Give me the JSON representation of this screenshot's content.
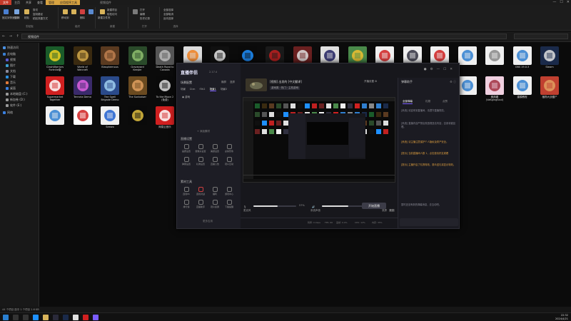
{
  "explorer": {
    "tabs": [
      "文件",
      "主页",
      "共享",
      "查看",
      "管理",
      "应用程序工具",
      "管理"
    ],
    "window_title": "视频组件",
    "center_title": "",
    "ribbon_groups": [
      "剪贴板",
      "组织",
      "新建",
      "打开",
      "选择"
    ],
    "ribbon_items": [
      "固定到快速访问",
      "复制",
      "粘贴",
      "剪切",
      "复制路径",
      "粘贴快捷方式",
      "移动到",
      "复制到",
      "删除",
      "重命名",
      "新建文件夹",
      "新建项目",
      "轻松访问",
      "属性",
      "打开",
      "编辑",
      "历史记录",
      "全部选择",
      "全部取消",
      "反向选择"
    ],
    "address_path": "视频组件",
    "nav_arrows": "← → ↑"
  },
  "sidebar": {
    "items": [
      "快速访问",
      "此电脑",
      "视频",
      "图片",
      "文档",
      "下载",
      "音乐",
      "桌面",
      "本地磁盘 (C:)",
      "新加卷 (D:)",
      "软件 (E:)",
      "网络"
    ]
  },
  "files": [
    {
      "label": "ClashWarriors Fortnite版",
      "color": "#1a5c2a",
      "accent": "#f0d020"
    },
    {
      "label": "World of Warcraft",
      "color": "#3a2a10",
      "accent": "#d4a94a"
    },
    {
      "label": "Blasphemous",
      "color": "#5a3a20",
      "accent": "#c08050"
    },
    {
      "label": "Graveyard Keeper",
      "color": "#2a4a2a",
      "accent": "#8fbf6f"
    },
    {
      "label": "Death Road to Canada",
      "color": "#555555",
      "accent": "#bbbbbb"
    },
    {
      "label": "Untitled Goose Game",
      "color": "#dcdcdc",
      "accent": "#f08020"
    },
    {
      "label": "Hollow Knight",
      "color": "#101010",
      "accent": "#e8e8e8"
    },
    {
      "label": "Internet Explorer",
      "color": "#0a0a0a",
      "accent": "#1e90ff"
    },
    {
      "label": "Ys",
      "color": "#1a1a1a",
      "accent": "#c02020"
    },
    {
      "label": "Hand of Fate",
      "color": "#6a2020",
      "accent": "#e0e0e0"
    },
    {
      "label": "Ramshackle",
      "color": "#e0e0e0",
      "accent": "#202060"
    },
    {
      "label": "Overcooked 2",
      "color": "#4a8a4a",
      "accent": "#f0c030"
    },
    {
      "label": "Unrailed!",
      "color": "#f0f0f0",
      "accent": "#d02020"
    },
    {
      "label": "SteamVR",
      "color": "#f0f0f0",
      "accent": "#303040"
    },
    {
      "label": "Nine Parchments",
      "color": "#f0f0f0",
      "accent": "#d02020"
    },
    {
      "label": "",
      "color": "#f0f0f0",
      "accent": "#2f7fd0"
    },
    {
      "label": "",
      "color": "#f0f0f0",
      "accent": "#888888"
    },
    {
      "label": "OBS 19.0.3",
      "color": "#f0f0f0",
      "accent": "#2f7fd0"
    },
    {
      "label": "Steam",
      "color": "#1a2a4a",
      "accent": "#e0e0e0"
    },
    {
      "label": "Supermarket Together",
      "color": "#d02020",
      "accent": "#ffffff"
    },
    {
      "label": "Terraria Demo",
      "color": "#3a2a6a",
      "accent": "#e060e0"
    },
    {
      "label": "The Spell Brigade Demo",
      "color": "#2a4a8a",
      "accent": "#a0d0f0"
    },
    {
      "label": "The Sunkaiser",
      "color": "#6a4a20",
      "accent": "#e0a060"
    },
    {
      "label": "To the Moon 2 (免费)",
      "color": "#0a0a0a",
      "accent": "#dddddd"
    },
    {
      "label": "",
      "color": "#0a0a0a",
      "accent": "#888888"
    },
    {
      "label": "大雁服务",
      "color": "#f0f0f0",
      "accent": "#e0a0c0"
    },
    {
      "label": "大理石模拟器",
      "color": "#2a5a8a",
      "accent": "#f0f0f0"
    },
    {
      "label": "魔兽世界",
      "color": "#2a2a2a",
      "accent": "#d4a94a"
    },
    {
      "label": "猫咪的小",
      "color": "#f0f0f0",
      "accent": "#2f7fd0"
    },
    {
      "label": "明星大乱斗",
      "color": "#d04020",
      "accent": "#ffffff"
    },
    {
      "label": "",
      "color": "#2a2a2a",
      "accent": "#e0e0e0"
    },
    {
      "label": "大雁逃脱",
      "color": "#d06020",
      "accent": "#ffffff"
    },
    {
      "label": "沙盒游戏",
      "color": "#f0f0f0",
      "accent": "#c03030"
    },
    {
      "label": "",
      "color": "#f0f0f0",
      "accent": "#b0b0b0"
    },
    {
      "label": "",
      "color": "#f0f0f0",
      "accent": "#2f7fd0"
    },
    {
      "label": "雅典娜(VaKgingSoul)",
      "color": "#f0d0e0",
      "accent": "#a03040"
    },
    {
      "label": "建模教程",
      "color": "#f0f0f0",
      "accent": "#2f7fd0"
    },
    {
      "label": "植物大战僵尸",
      "color": "#c04030",
      "accent": "#e0a060"
    },
    {
      "label": "",
      "color": "#f0f0f0",
      "accent": "#2f7fd0"
    },
    {
      "label": "",
      "color": "#ffffff",
      "accent": "#d02020"
    },
    {
      "label": "Seewo",
      "color": "#f0f0f0",
      "accent": "#2060d0"
    },
    {
      "label": "",
      "color": "#0a0a0a",
      "accent": "#e0c040"
    },
    {
      "label": "网易云音乐",
      "color": "#d02020",
      "accent": "#ffffff"
    },
    {
      "label": "",
      "color": "#20b020",
      "accent": "#ffffff"
    }
  ],
  "status_bar": "44 个项目   选中 1 个项目 1.6 KB",
  "taskbar": {
    "time": "22:32",
    "date": "2024/4/21"
  },
  "app": {
    "logo": "直播伴侣",
    "version": "2.17.4",
    "scene_header": "场景配置",
    "scene_tabs": [
      "横屏",
      "竖屏"
    ],
    "scene_items": [
      "场景",
      "D:m",
      "f3h2",
      "场景1",
      "场景2"
    ],
    "add_source": "+ 添加素材",
    "source_item": "游戏",
    "panel_quick": "直播设置",
    "quick_tools": [
      "画质设置",
      "摄像头设置",
      "美颜设置",
      "虚拟形象",
      "弹幕设置",
      "礼物设置",
      "直播公告",
      "观众互动"
    ],
    "panel_tools": "素材工具",
    "tools": [
      "连线PK",
      "连线对战",
      "福利",
      "游戏中心",
      "排行榜",
      "直播助手",
      "观众投屏",
      "下播提醒"
    ],
    "more_tools": "更多应用",
    "stream_title": "[视频] 出发的 [中文翻译]",
    "stream_category": "游戏类 · 热门 · 主机游戏",
    "top_right": "开播设置  ⚙",
    "chat_header": "弹幕助手",
    "chat_tabs": [
      "全部弹幕",
      "礼物",
      "点赞"
    ],
    "chat_lines": [
      "[系统] 欢迎来到直播间，请遵守直播规范。",
      "[系统] 直播内容严禁出现违规违法内容，否则将被处理。",
      "[系统] 请主播注意保护个人隐私及财产安全。",
      "[提示] 当前直播间人数 1，点击邀请好友观看",
      "[提示] 主播开启了礼物特效，观众送礼将显示特效。"
    ],
    "chat_empty": "暂时还没有新的弹幕消息，去互动吧。",
    "mixer": {
      "mic_label": "麦克风",
      "mic_level": 0.57,
      "mic_value": "57%",
      "sys_label": "系统声音",
      "sys_level": 0.61,
      "sys_value": "61%"
    },
    "bottom_icons": [
      "录屏",
      "美化",
      "回放"
    ],
    "start_button": "开始直播",
    "stats": [
      "码率: 0 kbps",
      "FPS: 60",
      "丢帧: 0.0%",
      "CPU: 12%",
      "内存: 35%"
    ]
  },
  "colors": {
    "accent": "#7a5cff",
    "explorer_tab_active": "#c43a2a",
    "explorer_tab_highlight": "#d9a441"
  }
}
